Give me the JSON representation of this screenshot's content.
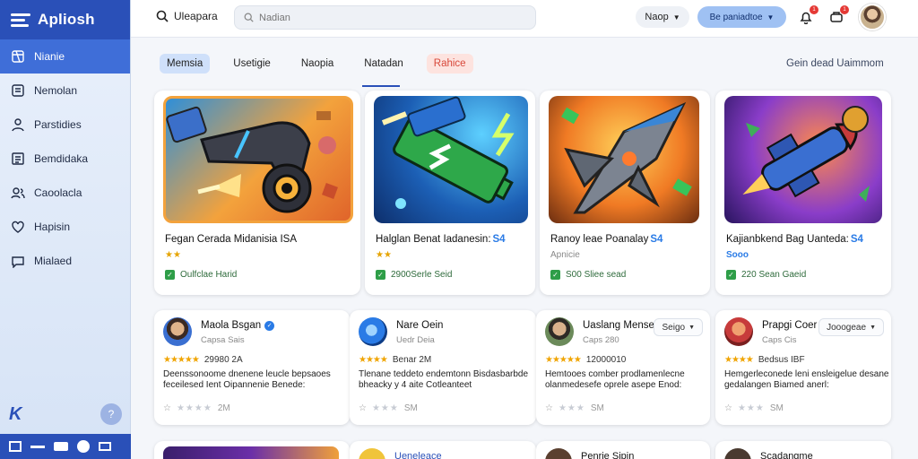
{
  "brand": {
    "name": "Apliosh",
    "color": "#2a50b8"
  },
  "sidebar": {
    "items": [
      {
        "label": "Nianie",
        "icon": "box-icon",
        "active": true
      },
      {
        "label": "Nemolan",
        "icon": "list-icon"
      },
      {
        "label": "Parstidies",
        "icon": "user-icon"
      },
      {
        "label": "Bemdidaka",
        "icon": "document-icon"
      },
      {
        "label": "Caoolacla",
        "icon": "people-icon"
      },
      {
        "label": "Hapisin",
        "icon": "heart-icon"
      },
      {
        "label": "Mialaed",
        "icon": "chat-icon"
      }
    ]
  },
  "topbar": {
    "search_label": "Uleapara",
    "search_placeholder": "Nadian",
    "select_label": "Naop",
    "primary_label": "Be paniadtoe",
    "notif_badge": "1",
    "cart_badge": "1"
  },
  "tabs": [
    {
      "label": "Memsia",
      "style": "blue"
    },
    {
      "label": "Usetigie",
      "style": "plain"
    },
    {
      "label": "Naopia",
      "style": "plain"
    },
    {
      "label": "Natadan",
      "style": "plain"
    },
    {
      "label": "Rahice",
      "style": "red"
    }
  ],
  "tabs_right": "Gein dead Uaimmom",
  "games": [
    {
      "title": "Fegan Cerada  Midanisia ISA",
      "stars": "★★",
      "meta": "Oulfclae Harid",
      "image": "cannon"
    },
    {
      "title": "Halglan Benat Iadanesin:",
      "stars": "★★",
      "meta": "2900Serle Seid",
      "image": "battery",
      "badge": "S4"
    },
    {
      "title": "Ranoy leae Poanalay",
      "sub": "Apnicie",
      "meta": "S00 Sliee sead",
      "image": "spaceship",
      "badge": "S4"
    },
    {
      "title": "Kajianbkend Bag Uanteda:",
      "stars": "Sooo",
      "meta": "220 Sean Gaeid",
      "image": "rocket",
      "badge": "S4",
      "stars_blue": true
    }
  ],
  "reviews": [
    {
      "name": "Maola Bsgan",
      "sub": "Capsa Sais",
      "rating_num": "29980 2A",
      "text": "Deenssonoome dnenene leucle bepsaoes feceilesed Ient Oipannenie Benede:",
      "foot": "2M",
      "verified": true
    },
    {
      "name": "Nare Oein",
      "sub": "Uedr Deia",
      "rating_num": "Benar 2M",
      "text": "Tlenane teddeto endemtonn Bisdasbarbde bheacky y 4 aite Cotleanteet",
      "foot": "SM"
    },
    {
      "name": "Uaslang Mense",
      "sub": "Caps 280",
      "rating_num": "12000010",
      "text": "Hemtooes comber prodlamenlecne olanmedesefe oprele asepe Enod:",
      "foot": "SM",
      "button": "Seigo"
    },
    {
      "name": "Prapgi Coer",
      "sub": "Caps Cis",
      "rating_num": "Bedsus IBF",
      "text": "Hemgerleconede leni ensleigelue desane gedalangen Biamed anerl:",
      "foot": "SM",
      "button": "Jooogeae"
    }
  ],
  "bottom": [
    {
      "label": ""
    },
    {
      "label": "Ueneleace"
    },
    {
      "label": "Penrie Sipin"
    },
    {
      "label": "Scadangme"
    }
  ]
}
